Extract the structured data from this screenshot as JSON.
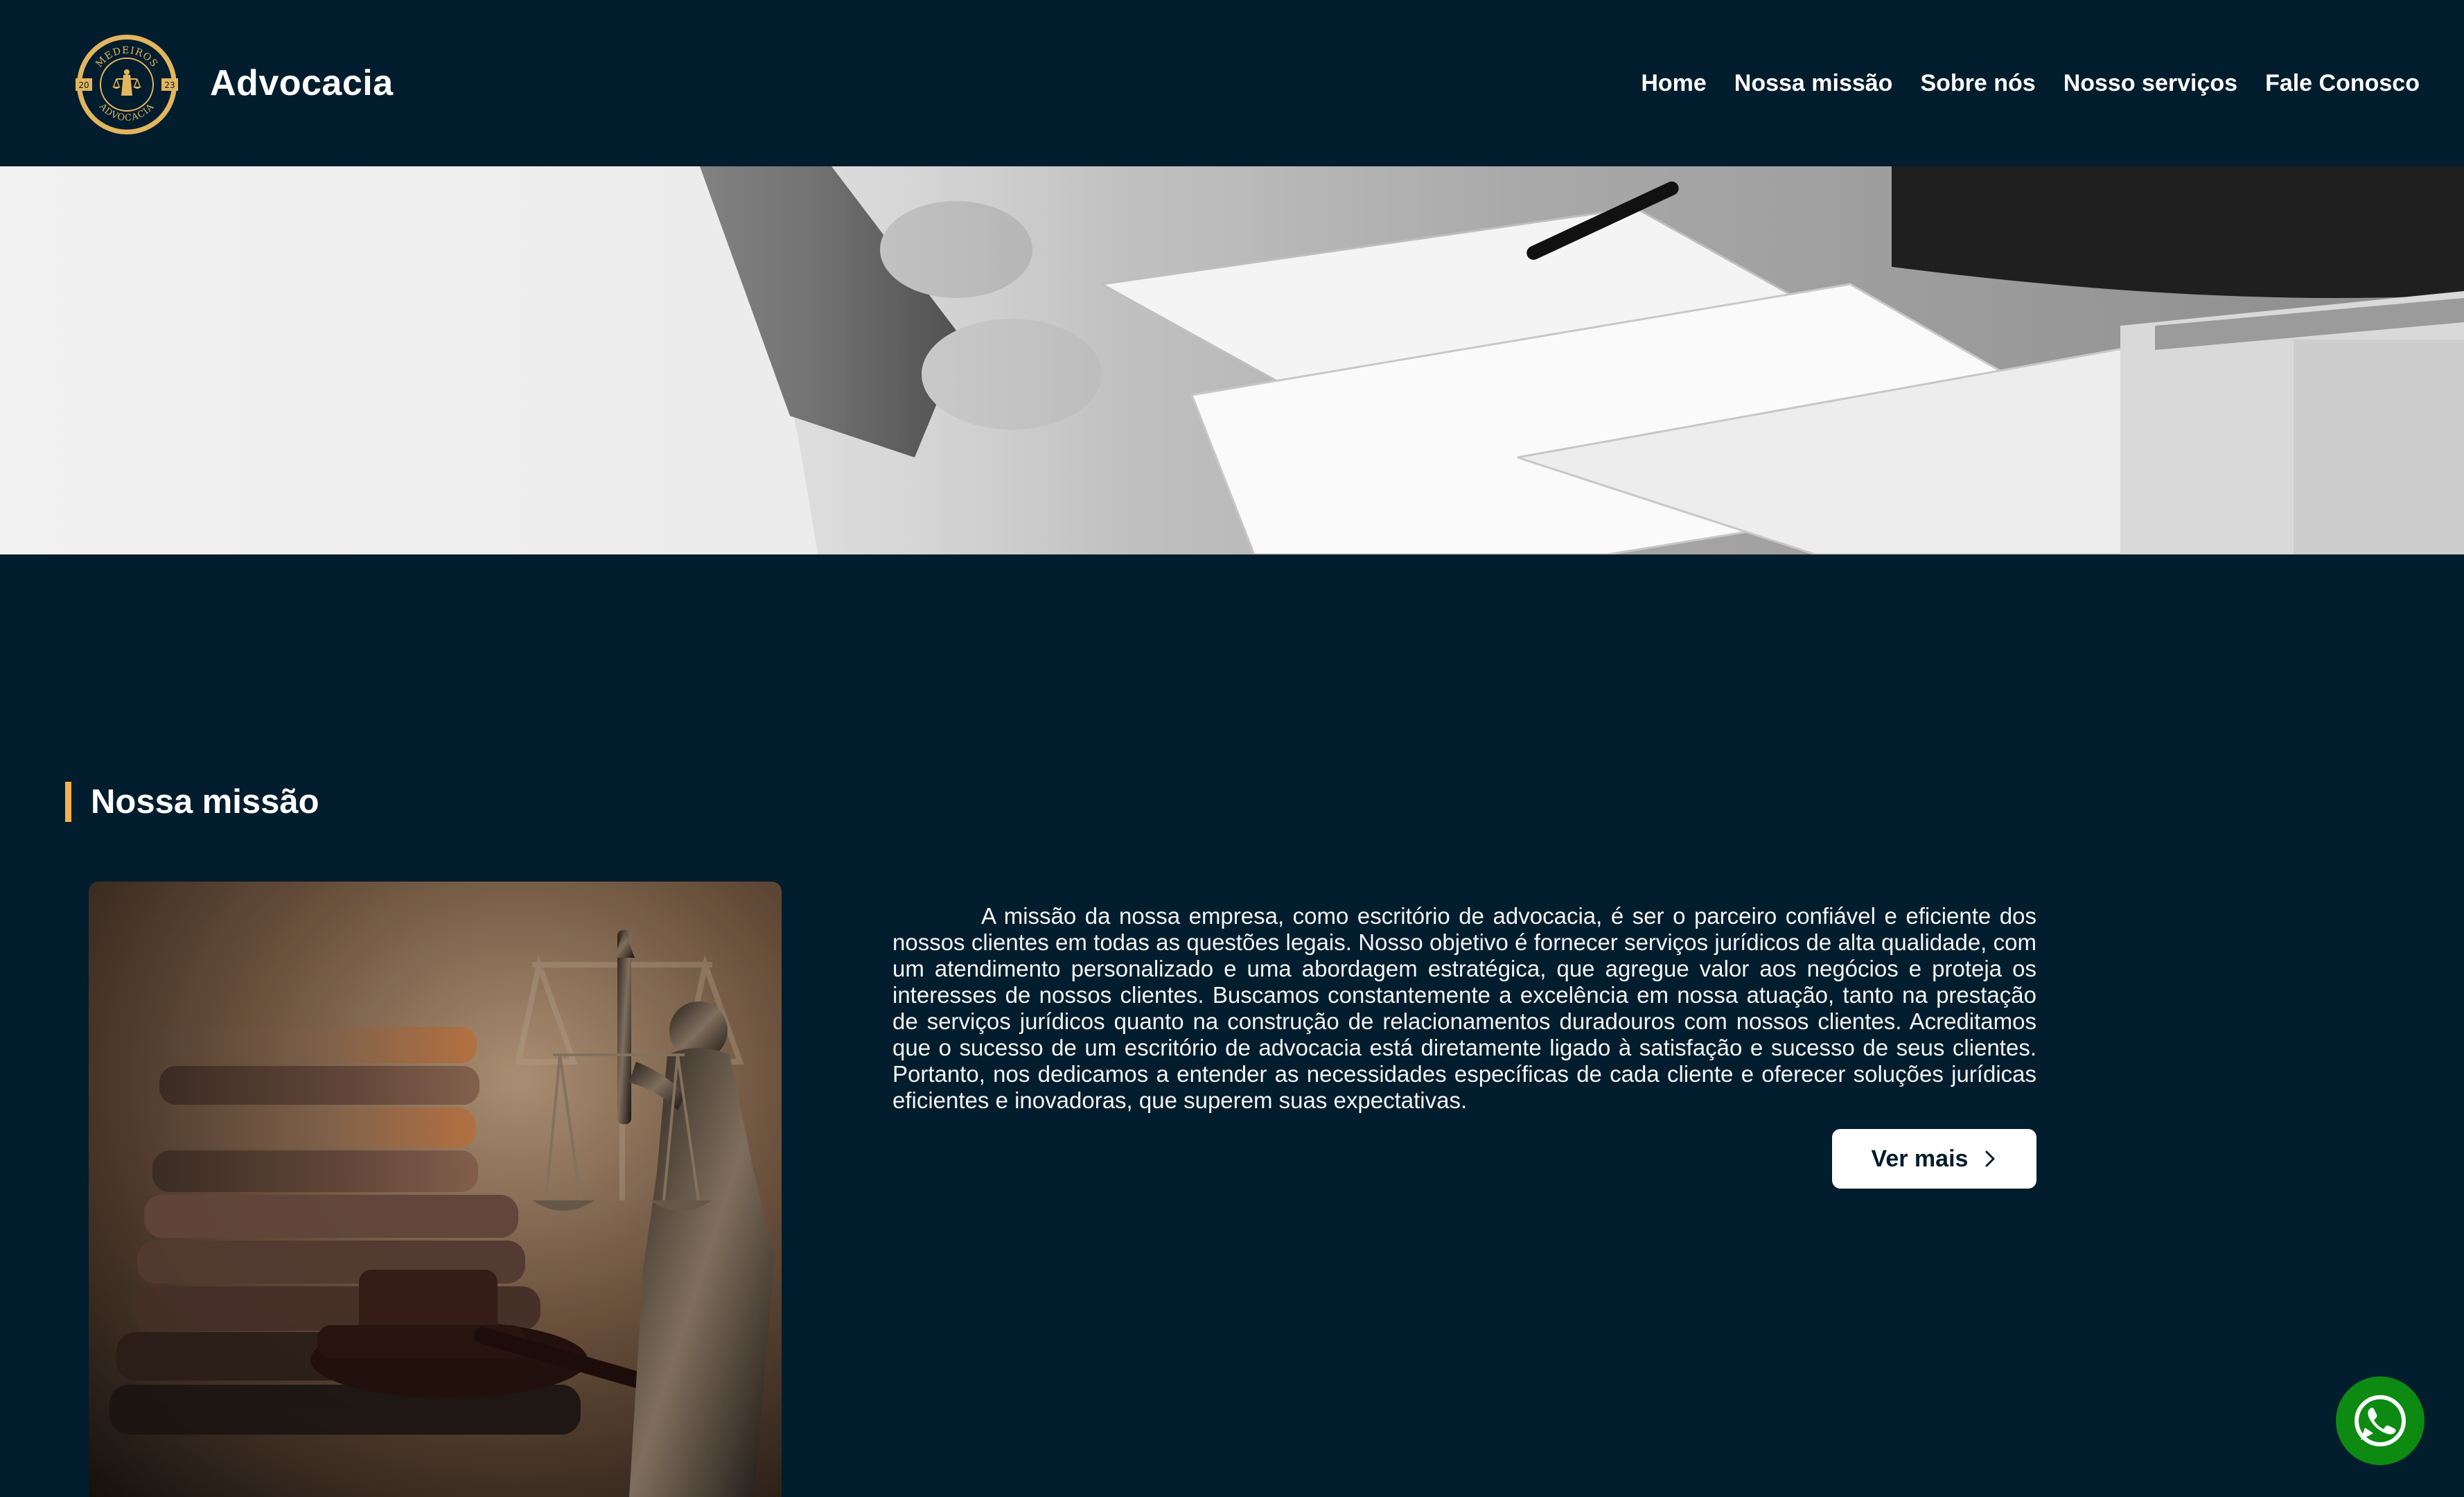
{
  "header": {
    "brand": "Advocacia",
    "logo": {
      "top_text": "MEDEIROS",
      "bottom_text": "ADVOCACIA",
      "left_year": "20",
      "right_year": "23"
    },
    "nav": [
      {
        "label": "Home"
      },
      {
        "label": "Nossa missão"
      },
      {
        "label": "Sobre nós"
      },
      {
        "label": "Nosso serviços"
      },
      {
        "label": "Fale Conosco"
      }
    ]
  },
  "mission": {
    "title": "Nossa missão",
    "text": "A missão da nossa empresa, como escritório de advocacia, é ser o parceiro confiável e eficiente dos nossos clientes em todas as questões legais. Nosso objetivo é fornecer serviços jurídicos de alta qualidade, com um atendimento personalizado e uma abordagem estratégica, que agregue valor aos negócios e proteja os interesses de nossos clientes. Buscamos constantemente a excelência em nossa atuação, tanto na prestação de serviços jurídicos quanto na construção de relacionamentos duradouros com nossos clientes. Acreditamos que o sucesso de um escritório de advocacia está diretamente ligado à satisfação e sucesso de seus clientes. Portanto, nos dedicamos a entender as necessidades específicas de cada cliente e oferecer soluções jurídicas eficientes e inovadoras, que superem suas expectativas.",
    "button_label": "Ver mais"
  },
  "colors": {
    "background": "#021d2d",
    "accent": "#f4b24e",
    "button_bg": "#ffffff",
    "whatsapp": "#0c8a12"
  },
  "icons": {
    "logo": "law-scales-seal-icon",
    "button": "chevron-right-icon",
    "floating": "whatsapp-icon"
  }
}
